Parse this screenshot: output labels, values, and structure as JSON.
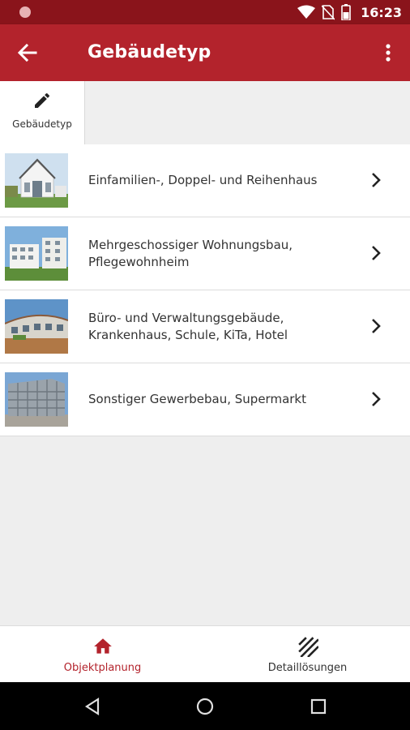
{
  "status_bar": {
    "time": "16:23"
  },
  "app_bar": {
    "title": "Gebäudetyp"
  },
  "subheader": {
    "tab_label": "Gebäudetyp"
  },
  "list": {
    "items": [
      {
        "label": "Einfamilien-, Doppel- und Reihenhaus",
        "icon": "house-photo"
      },
      {
        "label": "Mehrgeschossiger Wohnungsbau, Pflegewohnheim",
        "icon": "apartment-photo"
      },
      {
        "label": "Büro- und Verwaltungsgebäude, Krankenhaus, Schule, KiTa, Hotel",
        "icon": "office-photo"
      },
      {
        "label": "Sonstiger Gewerbebau, Supermarkt",
        "icon": "commercial-photo"
      }
    ]
  },
  "bottom_nav": {
    "items": [
      {
        "label": "Objektplanung",
        "icon": "home-icon",
        "active": true
      },
      {
        "label": "Detaillösungen",
        "icon": "hatch-icon",
        "active": false
      }
    ]
  },
  "colors": {
    "primary": "#b3232c",
    "primary_dark": "#8a141b"
  }
}
